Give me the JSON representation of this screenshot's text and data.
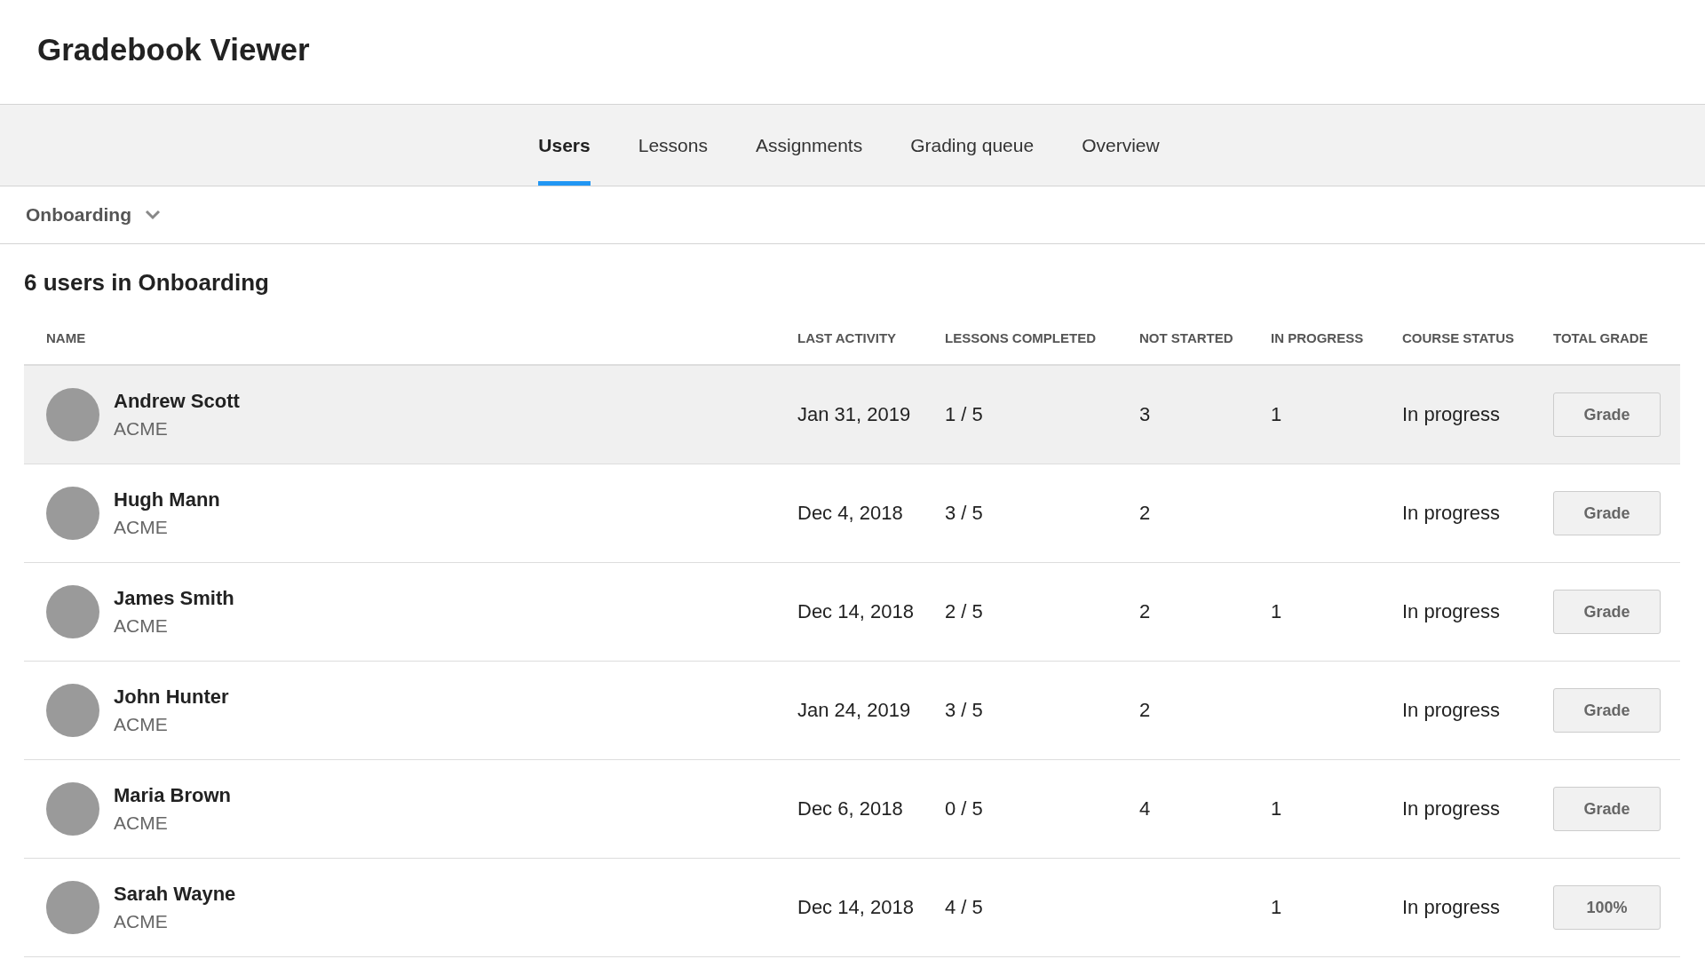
{
  "header": {
    "title": "Gradebook Viewer"
  },
  "tabs": [
    {
      "label": "Users",
      "selected": true
    },
    {
      "label": "Lessons",
      "selected": false
    },
    {
      "label": "Assignments",
      "selected": false
    },
    {
      "label": "Grading queue",
      "selected": false
    },
    {
      "label": "Overview",
      "selected": false
    }
  ],
  "filter": {
    "value": "Onboarding"
  },
  "heading": "6 users in Onboarding",
  "table": {
    "columns": [
      "NAME",
      "LAST ACTIVITY",
      "LESSONS COMPLETED",
      "NOT STARTED",
      "IN PROGRESS",
      "COURSE STATUS",
      "TOTAL GRADE"
    ],
    "rows": [
      {
        "name": "Andrew Scott",
        "company": "ACME",
        "last_activity": "Jan 31, 2019",
        "lessons_completed": "1 / 5",
        "not_started": "3",
        "in_progress": "1",
        "course_status": "In progress",
        "total_grade": "Grade",
        "highlighted": true
      },
      {
        "name": "Hugh Mann",
        "company": "ACME",
        "last_activity": "Dec 4, 2018",
        "lessons_completed": "3 / 5",
        "not_started": "2",
        "course_status": "In progress",
        "total_grade": "Grade",
        "highlighted": false
      },
      {
        "name": "James Smith",
        "company": "ACME",
        "last_activity": "Dec 14, 2018",
        "lessons_completed": "2 / 5",
        "not_started": "2",
        "in_progress": "1",
        "course_status": "In progress",
        "total_grade": "Grade",
        "highlighted": false
      },
      {
        "name": "John Hunter",
        "company": "ACME",
        "last_activity": "Jan 24, 2019",
        "lessons_completed": "3 / 5",
        "not_started": "2",
        "course_status": "In progress",
        "total_grade": "Grade",
        "highlighted": false
      },
      {
        "name": "Maria Brown",
        "company": "ACME",
        "last_activity": "Dec 6, 2018",
        "lessons_completed": "0 / 5",
        "not_started": "4",
        "in_progress": "1",
        "course_status": "In progress",
        "total_grade": "Grade",
        "highlighted": false
      },
      {
        "name": "Sarah Wayne",
        "company": "ACME",
        "last_activity": "Dec 14, 2018",
        "lessons_completed": "4 / 5",
        "in_progress": "1",
        "course_status": "In progress",
        "total_grade": "100%",
        "highlighted": false
      }
    ]
  }
}
